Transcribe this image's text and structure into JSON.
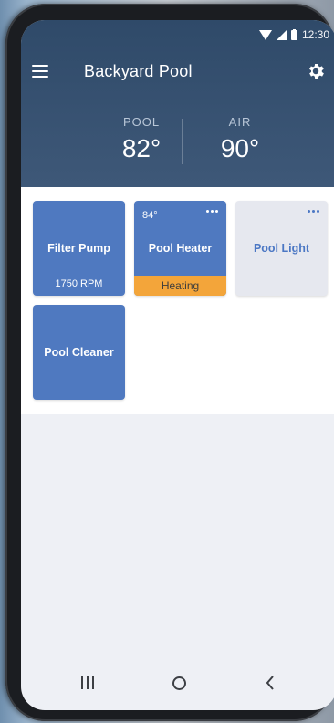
{
  "status_bar": {
    "time": "12:30"
  },
  "header": {
    "title": "Backyard Pool",
    "pool_label": "POOL",
    "pool_temp": "82°",
    "air_label": "AIR",
    "air_temp": "90°"
  },
  "tiles": [
    {
      "name": "Filter Pump",
      "sub": "1750 RPM"
    },
    {
      "name": "Pool Heater",
      "temp": "84°",
      "status": "Heating"
    },
    {
      "name": "Pool Light"
    },
    {
      "name": "Pool Cleaner"
    }
  ],
  "colors": {
    "header_bg": "#3e5878",
    "tile_active": "#4f79c0",
    "tile_inactive": "#e6e8ef",
    "heating_status": "#f3a53a"
  }
}
